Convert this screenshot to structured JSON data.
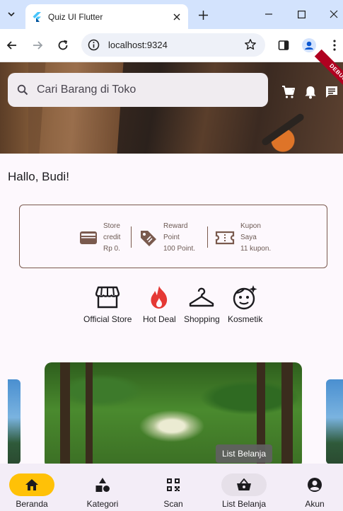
{
  "browser": {
    "tab_title": "Quiz UI Flutter",
    "url": "localhost:9324"
  },
  "header": {
    "search_placeholder": "Cari Barang di Toko",
    "debug_label": "DEBUG"
  },
  "greeting": "Hallo, Budi!",
  "wallet": {
    "items": [
      {
        "icon": "wallet-icon",
        "lines": [
          "Store",
          "credit",
          "Rp 0."
        ]
      },
      {
        "icon": "tag-icon",
        "lines": [
          "Reward",
          "Point",
          "100 Point."
        ]
      },
      {
        "icon": "ticket-icon",
        "lines": [
          "Kupon",
          "Saya",
          "11 kupon."
        ]
      }
    ]
  },
  "categories": [
    {
      "label": "Official Store",
      "icon": "storefront-icon"
    },
    {
      "label": "Hot Deal",
      "icon": "fire-icon"
    },
    {
      "label": "Shopping",
      "icon": "hanger-icon"
    },
    {
      "label": "Kosmetik",
      "icon": "face-sparkle-icon"
    }
  ],
  "tooltip": "List Belanja",
  "bottom_nav": {
    "items": [
      {
        "label": "Beranda",
        "icon": "home-icon"
      },
      {
        "label": "Kategori",
        "icon": "category-icon"
      },
      {
        "label": "Scan",
        "icon": "qr-code-icon"
      },
      {
        "label": "List Belanja",
        "icon": "basket-icon"
      },
      {
        "label": "Akun",
        "icon": "account-icon"
      }
    ],
    "selected": "Beranda",
    "hovered": "List Belanja"
  },
  "colors": {
    "accent_selected": "#ffc107",
    "hot_deal": "#e53935",
    "wallet_border": "#7a5a4e",
    "nav_bg": "#f3edf7"
  }
}
